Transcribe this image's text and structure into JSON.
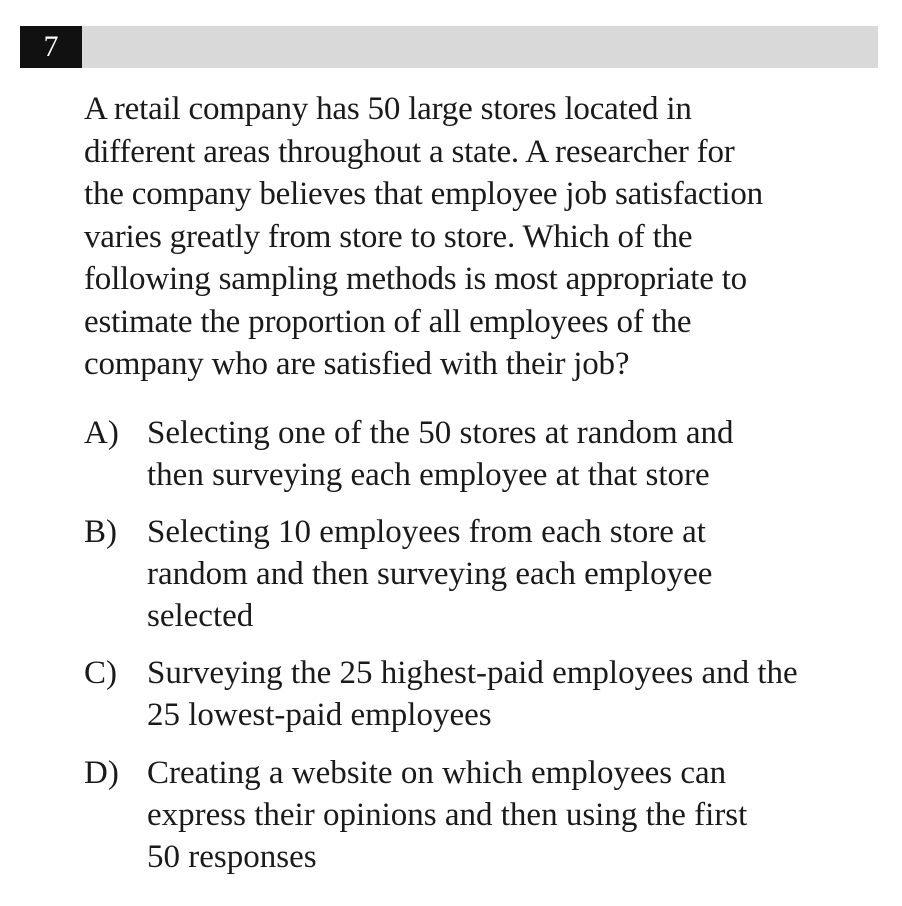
{
  "question": {
    "number": "7",
    "stem_lines": [
      "A retail company has 50 large stores located in",
      "different areas throughout a state. A researcher for",
      "the company believes that employee job satisfaction",
      "varies greatly from store to store. Which of the",
      "following sampling methods is most appropriate to",
      "estimate the proportion of all employees of the",
      "company who are satisfied with their job?"
    ]
  },
  "choices": [
    {
      "letter": "A)",
      "lines": [
        "Selecting one of the 50 stores at random and",
        "then surveying each employee at that store"
      ]
    },
    {
      "letter": "B)",
      "lines": [
        "Selecting 10 employees from each store at",
        "random and then surveying each employee",
        "selected"
      ]
    },
    {
      "letter": "C)",
      "lines": [
        "Surveying the 25 highest-paid employees and the",
        "25 lowest-paid employees"
      ]
    },
    {
      "letter": "D)",
      "lines": [
        "Creating a website on which employees can",
        "express their opinions and then using the first",
        "50 responses"
      ]
    }
  ]
}
